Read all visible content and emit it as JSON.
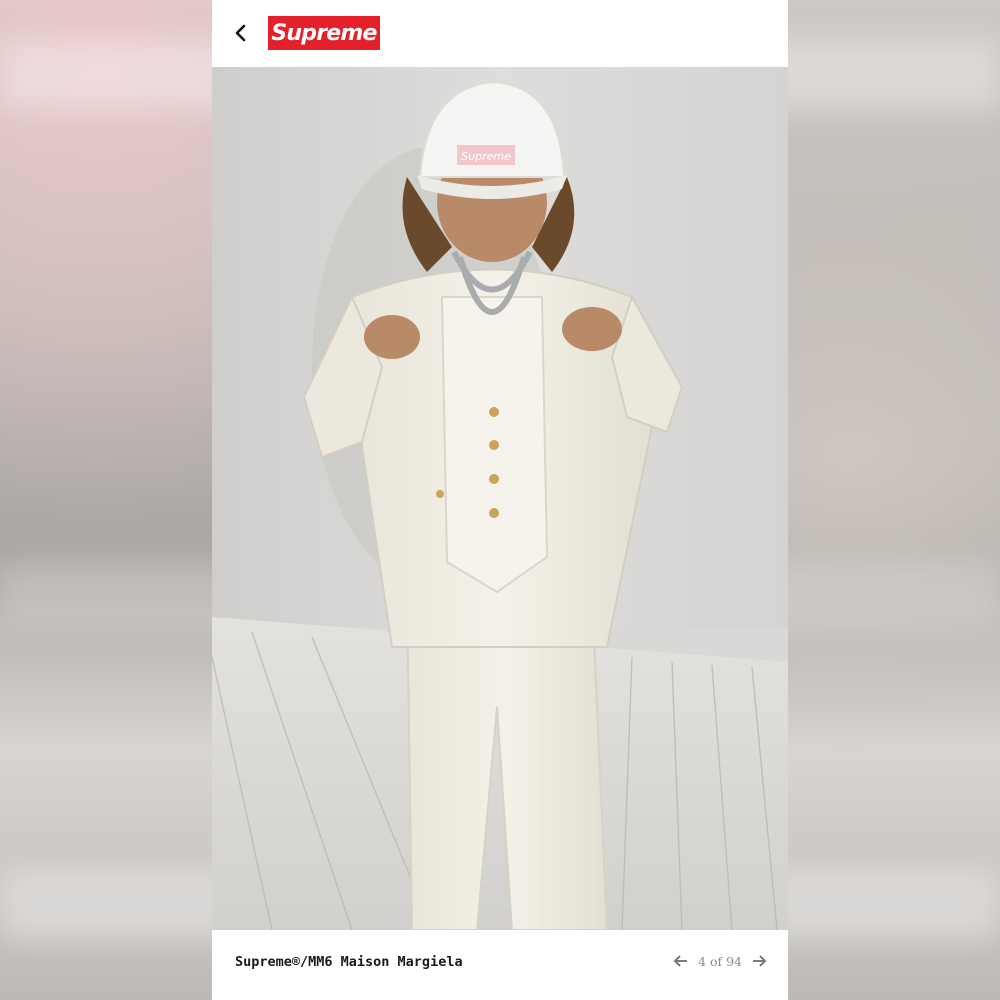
{
  "header": {
    "logo_text": "Supreme",
    "brand_color": "#e4202a",
    "back_icon": "chevron-left-icon"
  },
  "photo": {
    "subject": "Model in off-white suit with white Supreme cap"
  },
  "footer": {
    "caption": "Supreme®/MM6 Maison Margiela",
    "pager": {
      "current": 4,
      "total": 94,
      "label": "4 of 94",
      "prev_icon": "arrow-left-icon",
      "next_icon": "arrow-right-icon"
    }
  }
}
